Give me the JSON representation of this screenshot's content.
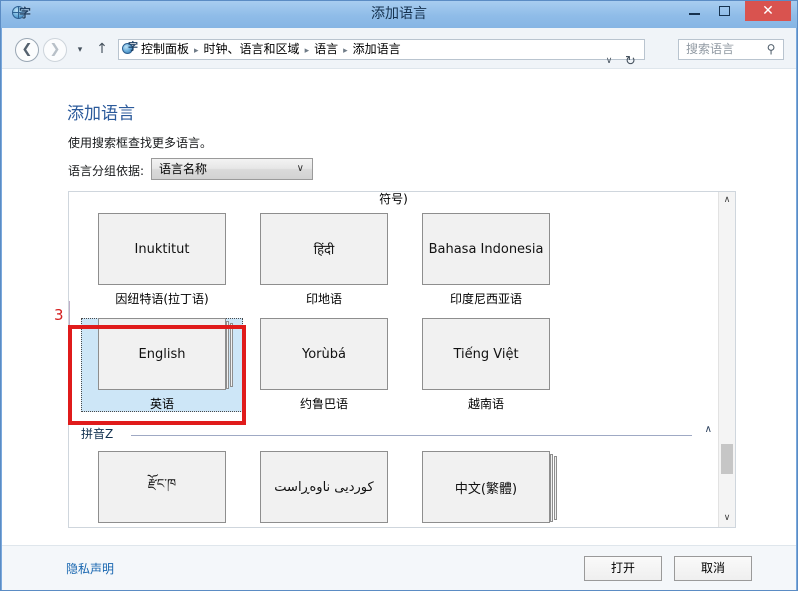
{
  "window": {
    "title": "添加语言",
    "icon": "language-globe-icon",
    "controls": {
      "minimize": "–",
      "maximize": "▭",
      "close": "✕"
    }
  },
  "navbar": {
    "back": "❮",
    "forward": "❯",
    "recent": "▾",
    "up": "↑",
    "breadcrumbs": [
      "控制面板",
      "时钟、语言和区域",
      "语言",
      "添加语言"
    ],
    "separator": "▸",
    "dropdown": "∨",
    "refresh": "↻",
    "search": {
      "placeholder": "搜索语言",
      "icon": "⚲"
    }
  },
  "page": {
    "title": "添加语言",
    "subtitle": "使用搜索框查找更多语言。",
    "group_by_label": "语言分组依据:",
    "group_by_value": "语言名称",
    "group_by_arrow": "∨"
  },
  "list": {
    "partial_group_header": "符号)",
    "rows": [
      {
        "type": "tiles",
        "tiles": [
          {
            "native": "Inuktitut",
            "label": "因纽特语(拉丁语)",
            "selected": false,
            "stacked": false
          },
          {
            "native": "हिंदी",
            "label": "印地语",
            "selected": false,
            "stacked": false
          },
          {
            "native": "Bahasa Indonesia",
            "label": "印度尼西亚语",
            "selected": false,
            "stacked": false
          }
        ]
      },
      {
        "type": "tiles",
        "tiles": [
          {
            "native": "English",
            "label": "英语",
            "selected": true,
            "stacked": true
          },
          {
            "native": "Yorùbá",
            "label": "约鲁巴语",
            "selected": false,
            "stacked": false
          },
          {
            "native": "Tiếng Việt",
            "label": "越南语",
            "selected": false,
            "stacked": false
          }
        ]
      },
      {
        "type": "group",
        "title": "拼音Z",
        "chevron": "∧"
      },
      {
        "type": "tiles",
        "tiles": [
          {
            "native": "རྫོང་ཁ",
            "label": "",
            "selected": false,
            "stacked": false
          },
          {
            "native": "کوردیی ناوەڕاست",
            "label": "",
            "selected": false,
            "stacked": false
          },
          {
            "native": "中文(繁體)",
            "label": "",
            "selected": false,
            "stacked": true
          }
        ]
      }
    ],
    "scrollbar": {
      "up_arrow": "∧",
      "down_arrow": "∨"
    }
  },
  "footer": {
    "privacy_link": "隐私声明",
    "open_button": "打开",
    "cancel_button": "取消"
  },
  "annotation": {
    "number": "3",
    "color": "#e01b1b",
    "target": "english-tile"
  }
}
